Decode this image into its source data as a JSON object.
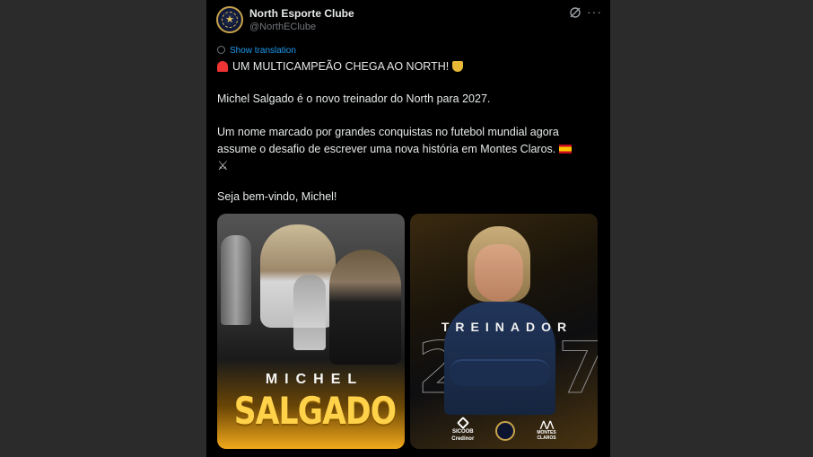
{
  "account": {
    "name": "North Esporte Clube",
    "handle": "@NorthEClube"
  },
  "post": {
    "show_translation": "Show translation",
    "headline": "UM MULTICAMPEÃO CHEGA AO NORTH!",
    "line1": "Michel Salgado é o novo treinador do North para 2027.",
    "line2a": "Um nome marcado por grandes conquistas no futebol mundial agora",
    "line2b": "assume o desafio de escrever uma nova história em Montes Claros.",
    "line3": "Seja bem-vindo, Michel!"
  },
  "icons": {
    "headline_start": "police-siren-icon",
    "headline_end": "trophy-icon",
    "line2_end": "spain-flag-icon",
    "swords": "crossed-swords-icon",
    "swords_glyph": "⚔"
  },
  "media": {
    "left": {
      "first_name": "MICHEL",
      "last_name": "SALGADO"
    },
    "right": {
      "role": "TREINADOR",
      "year": "2027",
      "sponsor": "SICOOB",
      "sponsor_sub": "Credinor",
      "partner_line1": "MONTES",
      "partner_line2": "CLAROS"
    }
  },
  "colors": {
    "background": "#000000",
    "link": "#1d9bf0",
    "gold": "#ffd24a",
    "muted": "#71767b"
  }
}
